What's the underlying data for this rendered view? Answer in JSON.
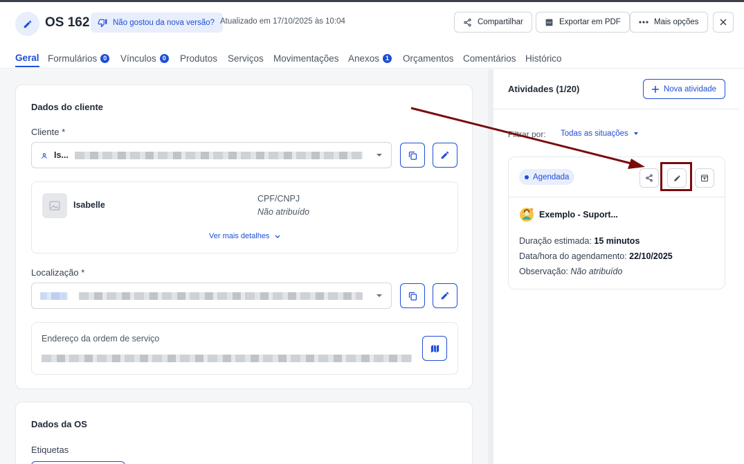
{
  "header": {
    "title": "OS 162",
    "feedback_label": "Não gostou da nova versão?",
    "updated_text": "Atualizado em 17/10/2025 às 10:04",
    "share_label": "Compartilhar",
    "export_label": "Exportar em PDF",
    "more_label": "Mais opções"
  },
  "tabs": [
    {
      "label": "Geral",
      "active": true
    },
    {
      "label": "Formulários",
      "badge": "0"
    },
    {
      "label": "Vínculos",
      "badge": "0"
    },
    {
      "label": "Produtos"
    },
    {
      "label": "Serviços"
    },
    {
      "label": "Movimentações"
    },
    {
      "label": "Anexos",
      "badge": "1"
    },
    {
      "label": "Orçamentos"
    },
    {
      "label": "Comentários"
    },
    {
      "label": "Histórico"
    }
  ],
  "client_card": {
    "title": "Dados do cliente",
    "client_label": "Cliente *",
    "client_value_prefix": "Is...",
    "client_name": "Isabelle",
    "cpf_label": "CPF/CNPJ",
    "cpf_value": "Não atribuído",
    "more_details": "Ver mais detalhes",
    "location_label": "Localização *",
    "address_label": "Endereço da ordem de serviço"
  },
  "os_card": {
    "title": "Dados da OS",
    "tags_label": "Etiquetas"
  },
  "activities": {
    "title": "Atividades (1/20)",
    "new_label": "Nova atividade",
    "filter_label": "Filtrar por:",
    "filter_value": "Todas as situações",
    "card": {
      "status": "Agendada",
      "name": "Exemplo - Suport...",
      "duration_label": "Duração estimada:",
      "duration_value": "15 minutos",
      "schedule_label": "Data/hora do agendamento:",
      "schedule_value": "22/10/2025",
      "note_label": "Observação:",
      "note_value": "Não atribuído"
    }
  },
  "colors": {
    "accent": "#1d4ed8",
    "accent_light": "#e8eefc",
    "annotation": "#7a0b0b"
  }
}
